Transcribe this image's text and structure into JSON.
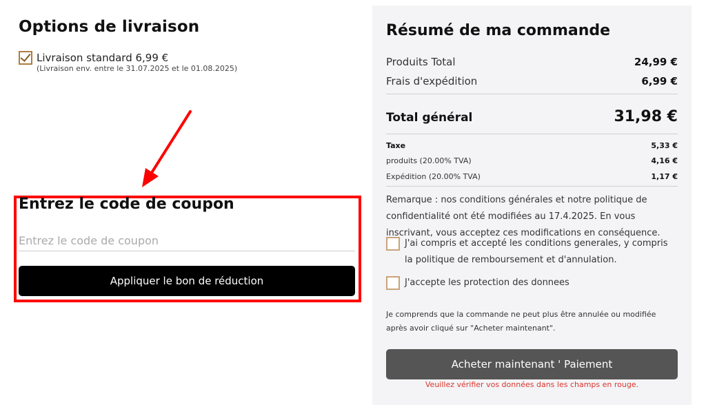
{
  "shipping": {
    "title": "Options de livraison",
    "option_label": "Livraison standard 6,99 €",
    "option_sub": "(Livraison env. entre le 31.07.2025 et le 01.08.2025)",
    "option_checked": true
  },
  "coupon": {
    "title": "Entrez le code de coupon",
    "placeholder": "Entrez le code de coupon",
    "value": "",
    "button_label": "Appliquer le bon de réduction",
    "highlight_color": "#ff0000",
    "annotation_arrow_color": "#ff0000"
  },
  "summary": {
    "title": "Résumé de ma commande",
    "products_total_label": "Produits Total",
    "products_total_value": "24,99 €",
    "shipping_fee_label": "Frais d'expédition",
    "shipping_fee_value": "6,99 €",
    "grand_total_label": "Total général",
    "grand_total_value": "31,98 €",
    "tax_label": "Taxe",
    "tax_value": "5,33 €",
    "products_tva_label": "produits (20.00% TVA)",
    "products_tva_value": "4,16 €",
    "shipping_tva_label": "Expédition (20.00% TVA)",
    "shipping_tva_value": "1,17 €",
    "remark": "Remarque : nos conditions générales et notre politique de confidentialité ont été modifiées au 17.4.2025. En vous inscrivant, vous acceptez ces modifications en conséquence.",
    "agree_terms": "J'ai compris et accepté les conditions generales, y compris la politique de remboursement et d'annulation.",
    "agree_privacy": "J'accepte les protection des donnees",
    "notice": "Je comprends que la commande ne peut plus être annulée ou modifiée après avoir cliqué sur \"Acheter maintenant\".",
    "buy_button_label": "Acheter maintenant ' Paiement",
    "error_message": "Veuillez vérifier vos données dans les champs en rouge."
  },
  "colors": {
    "checkbox_border": "#c9a37a",
    "panel_background": "#f4f4f6",
    "buy_button": "#555555",
    "error_text": "#d9362f"
  }
}
